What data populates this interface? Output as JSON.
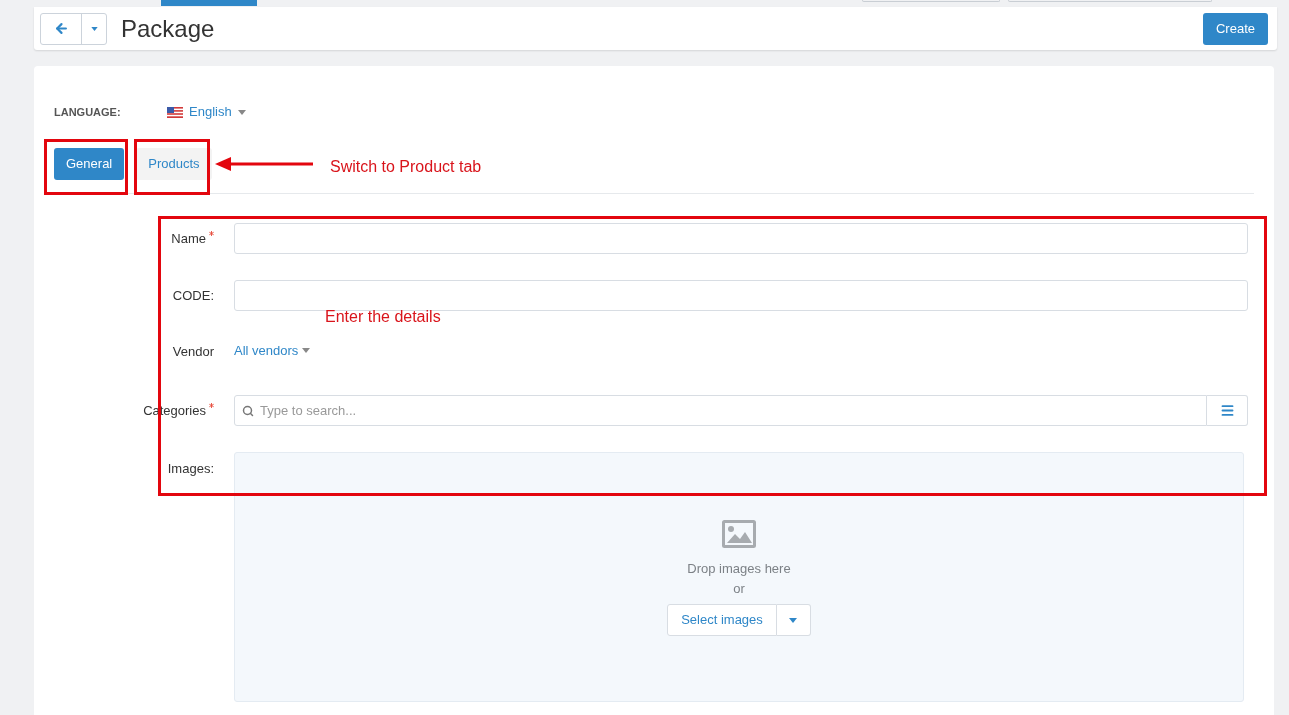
{
  "header": {
    "title": "Package",
    "create_button": "Create"
  },
  "language": {
    "label": "LANGUAGE:",
    "value": "English"
  },
  "tabs": [
    {
      "label": "General",
      "selected": true
    },
    {
      "label": "Products",
      "selected": false
    }
  ],
  "form": {
    "fields": [
      {
        "kind": "text",
        "label": "Name",
        "required": true
      },
      {
        "kind": "text",
        "label": "CODE:",
        "required": false
      },
      {
        "kind": "dropdown",
        "label": "Vendor",
        "required": false,
        "value": "All vendors"
      },
      {
        "kind": "search",
        "label": "Categories",
        "required": true,
        "placeholder": "Type to search..."
      },
      {
        "kind": "images",
        "label": "Images:",
        "required": false,
        "drop_text": "Drop images here",
        "or_text": "or",
        "button": "Select images"
      }
    ]
  },
  "annotations": [
    {
      "kind": "tab_callout",
      "text": "Switch to Product tab"
    },
    {
      "kind": "form_callout",
      "text": "Enter the details"
    }
  ]
}
